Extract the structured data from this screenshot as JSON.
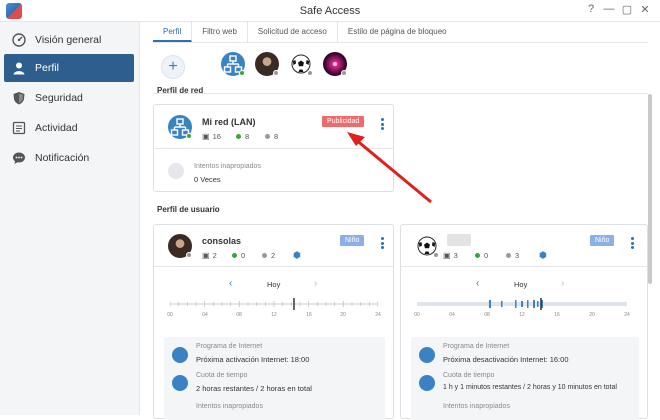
{
  "window": {
    "title": "Safe Access"
  },
  "sidebar": {
    "items": [
      {
        "label": "Visión general",
        "icon": "gauge-icon"
      },
      {
        "label": "Perfil",
        "icon": "person-icon",
        "active": true
      },
      {
        "label": "Seguridad",
        "icon": "shield-icon"
      },
      {
        "label": "Actividad",
        "icon": "list-icon"
      },
      {
        "label": "Notificación",
        "icon": "chat-icon"
      }
    ]
  },
  "tabs": [
    {
      "label": "Perfil",
      "active": true
    },
    {
      "label": "Filtro web"
    },
    {
      "label": "Solicitud de acceso"
    },
    {
      "label": "Estilo de página de bloqueo"
    }
  ],
  "avatar_bar": {
    "add_label": "+"
  },
  "network_section": {
    "title": "Perfil de red",
    "card": {
      "name": "Mi red (LAN)",
      "badge": "Publicidad",
      "devices": "16",
      "online": "8",
      "offline": "8",
      "inappropriate_label": "Intentos inapropiados",
      "inappropriate_value": "0 Veces"
    }
  },
  "user_section": {
    "title": "Perfil de usuario",
    "cards": [
      {
        "name": "consolas",
        "badge": "Niño",
        "devices": "2",
        "online": "0",
        "offline": "2",
        "date_label": "Hoy",
        "ticks": [
          "00",
          "04",
          "08",
          "12",
          "16",
          "20",
          "24"
        ],
        "schedule_label": "Programa de Internet",
        "schedule_value": "Próxima activación Internet: 18:00",
        "quota_label": "Cuota de tiempo",
        "quota_value": "2 horas restantes / 2 horas en total",
        "inappropriate_label": "Intentos inapropiados"
      },
      {
        "name": "",
        "badge": "Niño",
        "devices": "3",
        "online": "0",
        "offline": "3",
        "date_label": "Hoy",
        "ticks": [
          "00",
          "04",
          "08",
          "12",
          "16",
          "20",
          "24"
        ],
        "schedule_label": "Programa de Internet",
        "schedule_value": "Próxima desactivación Internet: 16:00",
        "quota_label": "Cuota de tiempo",
        "quota_value": "1 h y 1 minutos restantes / 2 horas y 10 minutos en total",
        "inappropriate_label": "Intentos inapropiados"
      }
    ]
  },
  "annotation": {
    "arrow_color": "#e0201b"
  },
  "colors": {
    "accent": "#2f6fb5",
    "sidebar_active": "#2e5e8e",
    "badge_red": "#ef6b6b",
    "badge_blue": "#8ab0e6",
    "online": "#3aa53a",
    "offline": "#999999"
  }
}
